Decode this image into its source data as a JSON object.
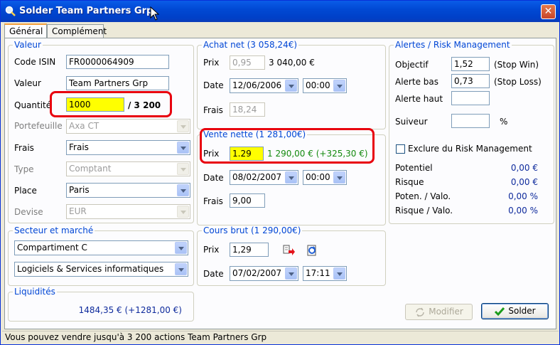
{
  "window": {
    "title": "Solder Team Partners Grp"
  },
  "tabs": [
    {
      "label": "Général"
    },
    {
      "label": "Complément"
    }
  ],
  "valeur": {
    "title": "Valeur",
    "isin_label": "Code ISIN",
    "isin": "FR0000064909",
    "valeur_label": "Valeur",
    "valeur": "Team Partners Grp",
    "quantite_label": "Quantité",
    "quantite": "1000",
    "quantite_total": "/ 3 200",
    "portefeuille_label": "Portefeuille",
    "portefeuille": "Axa CT",
    "frais_label": "Frais",
    "frais": "Frais",
    "type_label": "Type",
    "type": "Comptant",
    "place_label": "Place",
    "place": "Paris",
    "devise_label": "Devise",
    "devise": "EUR"
  },
  "secteur": {
    "title": "Secteur et marché",
    "compartiment": "Compartiment C",
    "secteur": "Logiciels & Services informatiques"
  },
  "liquidites": {
    "title": "Liquidités",
    "value": "1484,35 € (+1281,00 €)"
  },
  "achat": {
    "title": "Achat net (3 058,24€)",
    "prix_label": "Prix",
    "prix": "0,95",
    "prix_total": "3 040,00 €",
    "date_label": "Date",
    "date": "12/06/2006",
    "time": "00:00",
    "frais_label": "Frais",
    "frais": "18,24"
  },
  "vente": {
    "title": "Vente nette (1 281,00€)",
    "prix_label": "Prix",
    "prix": "1.29",
    "prix_total": "1 290,00 € (+325,30 €)",
    "date_label": "Date",
    "date": "08/02/2007",
    "time": "00:00",
    "frais_label": "Frais",
    "frais": "9,00"
  },
  "cours": {
    "title": "Cours brut (1 290,00€)",
    "prix_label": "Prix",
    "prix": "1,29",
    "date_label": "Date",
    "date": "07/02/2007",
    "time": "17:11"
  },
  "alertes": {
    "title": "Alertes / Risk Management",
    "objectif_label": "Objectif",
    "objectif": "1,52",
    "objectif_note": "(Stop Win)",
    "alerte_bas_label": "Alerte bas",
    "alerte_bas": "0,73",
    "alerte_bas_note": "(Stop Loss)",
    "alerte_haut_label": "Alerte haut",
    "alerte_haut": "",
    "suiveur_label": "Suiveur",
    "suiveur": "",
    "suiveur_unit": "%",
    "exclure_label": "Exclure du Risk Management",
    "potentiel_label": "Potentiel",
    "potentiel": "0,00 €",
    "risque_label": "Risque",
    "risque": "0,00 €",
    "poten_valo_label": "Poten. / Valo.",
    "poten_valo": "0,00 %",
    "risque_valo_label": "Risque / Valo.",
    "risque_valo": "0,00 %"
  },
  "buttons": {
    "modifier": "Modifier",
    "solder": "Solder"
  },
  "status": "Vous pouvez vendre jusqu'à 3 200 actions Team Partners Grp"
}
